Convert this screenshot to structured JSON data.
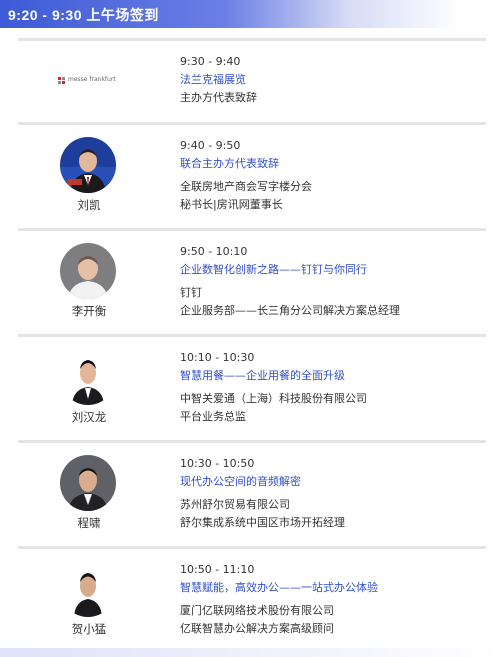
{
  "header": {
    "title": "9:20 - 9:30  上午场签到"
  },
  "sessions": [
    {
      "logo_text": "messe frankfurt",
      "time": "9:30 - 9:40",
      "topic": "法兰克福展览",
      "company": "主办方代表致辞",
      "role": ""
    },
    {
      "name": "刘凯",
      "time": "9:40 - 9:50",
      "topic": "联合主办方代表致辞",
      "company": "全联房地产商会写字楼分会",
      "role": "秘书长|房讯网董事长"
    },
    {
      "name": "李开衡",
      "time": "9:50 - 10:10",
      "topic": "企业数智化创新之路——钉钉与你同行",
      "company": "钉钉",
      "role": "企业服务部——长三角分公司解决方案总经理"
    },
    {
      "name": "刘汉龙",
      "time": "10:10 - 10:30",
      "topic": "智慧用餐——企业用餐的全面升级",
      "company": "中智关爱通（上海）科技股份有限公司",
      "role": "平台业务总监"
    },
    {
      "name": "程啸",
      "time": "10:30 - 10:50",
      "topic": "现代办公空间的音频解密",
      "company": "苏州舒尔贸易有限公司",
      "role": "舒尔集成系统中国区市场开拓经理"
    },
    {
      "name": "贺小猛",
      "time": "10:50 - 11:10",
      "topic": "智慧赋能，高效办公——一站式办公体验",
      "company": "厦门亿联网络技术股份有限公司",
      "role": "亿联智慧办公解决方案高级顾问"
    }
  ]
}
